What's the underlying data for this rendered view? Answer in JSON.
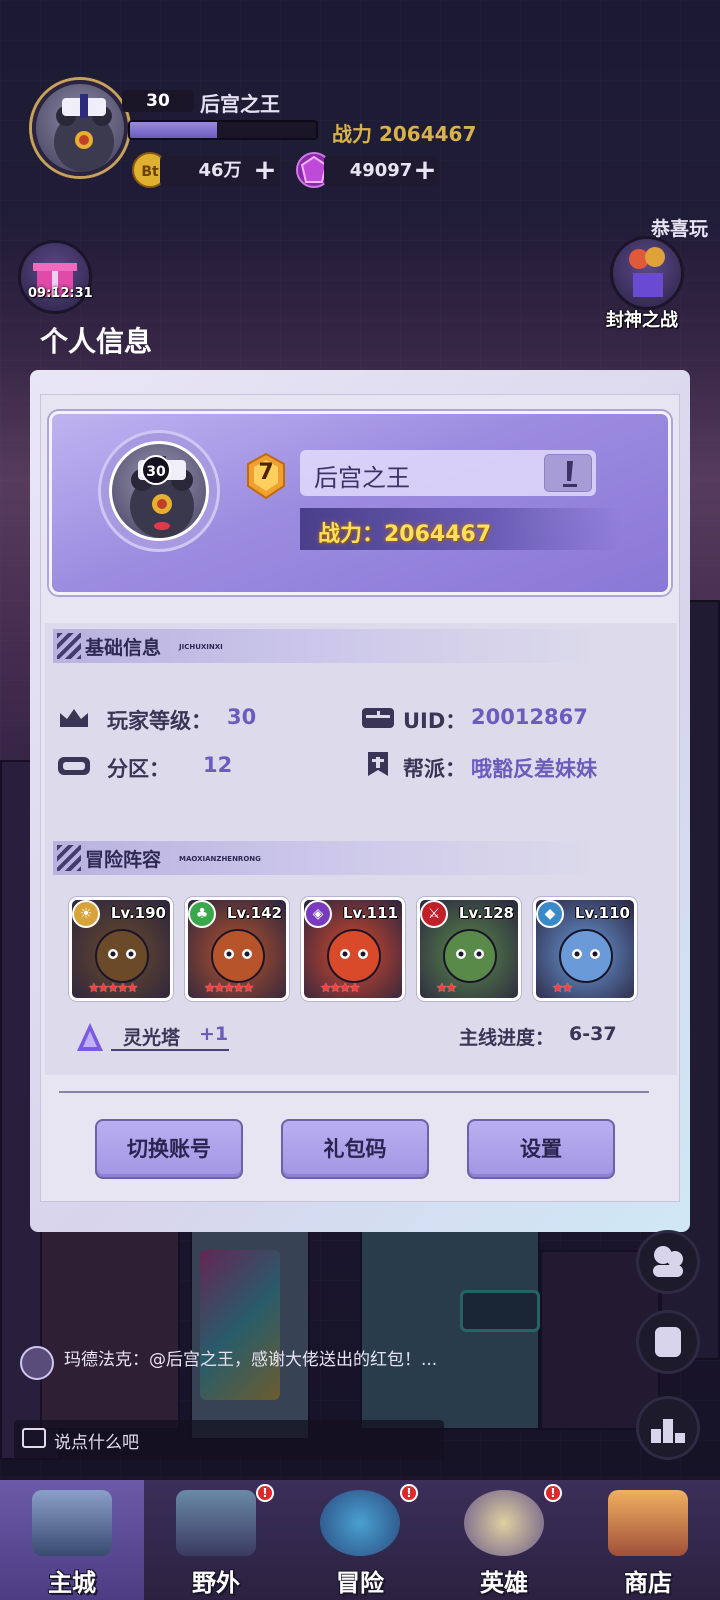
{
  "hud": {
    "level": "30",
    "player_name": "后宫之王",
    "exp_progress": 0.47,
    "power_text": "战力 2064467",
    "coins": "46万",
    "coin_icon_text": "Bt",
    "gems": "49097",
    "right_banner_text": "恭喜玩",
    "timer": "09:12:31",
    "side_event_label": "封神之战"
  },
  "modal": {
    "title": "个人信息",
    "profile": {
      "avatar_level": "30",
      "vip_level": "7",
      "name": "后宫之王",
      "power": "战力：2064467"
    },
    "basic_section": {
      "title": "基础信息",
      "subtitle": "JICHUXINXI",
      "player_level_label": "玩家等级：",
      "player_level_value": "30",
      "uid_label": "UID：",
      "uid_value": "20012867",
      "zone_label": "分区：",
      "zone_value": "12",
      "guild_label": "帮派：",
      "guild_value": "哦豁反差妹妹"
    },
    "team_section": {
      "title": "冒险阵容",
      "subtitle": "MAOXIANZHENRONG",
      "heroes": [
        {
          "level": "Lv.190",
          "element": "sun",
          "stars": 5,
          "color": "#d8a33a",
          "bg": "#6b4a2a"
        },
        {
          "level": "Lv.142",
          "element": "leaf",
          "stars": 5,
          "color": "#3aa84a",
          "bg": "#b8542a"
        },
        {
          "level": "Lv.111",
          "element": "void",
          "stars": 4,
          "color": "#7a3ac0",
          "bg": "#d84a2a"
        },
        {
          "level": "Lv.128",
          "element": "claw",
          "stars": 2,
          "color": "#c0202a",
          "bg": "#5a8a4a"
        },
        {
          "level": "Lv.110",
          "element": "water",
          "stars": 2,
          "color": "#3a8ac8",
          "bg": "#6a9ad8"
        }
      ],
      "tower_name": "灵光塔",
      "tower_bonus": "+1",
      "progress_label": "主线进度：",
      "progress_value": "6-37"
    },
    "buttons": {
      "switch_account": "切换账号",
      "gift_code": "礼包码",
      "settings": "设置"
    }
  },
  "chat": {
    "message": "玛德法克：@后宫之王，感谢大佬送出的红包！...",
    "placeholder": "说点什么吧"
  },
  "nav": {
    "items": [
      {
        "label": "主城"
      },
      {
        "label": "野外"
      },
      {
        "label": "冒险"
      },
      {
        "label": "英雄"
      },
      {
        "label": "商店"
      }
    ]
  }
}
